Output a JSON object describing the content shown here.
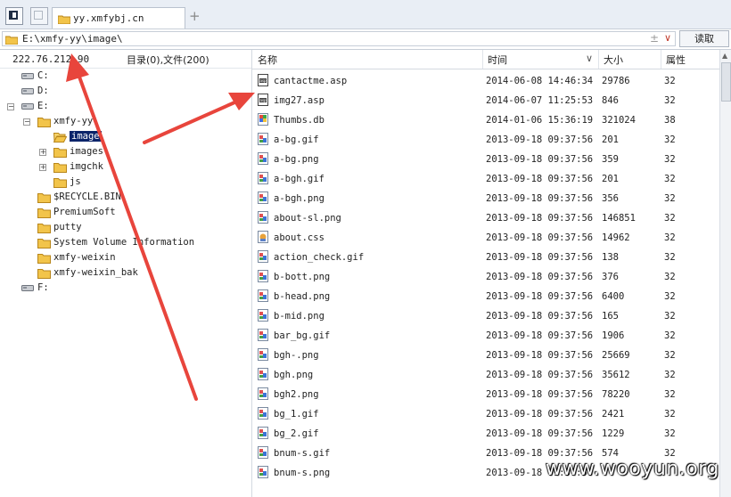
{
  "tabs": {
    "active_label": "yy.xmfybj.cn",
    "add_symbol": "+"
  },
  "address": {
    "path": "E:\\xmfy-yy\\image\\",
    "plus_symbol": "±",
    "dropdown_symbol": "∨",
    "read_button": "读取"
  },
  "left_header": {
    "ip": "222.76.212.90",
    "summary": "目录(0),文件(200)"
  },
  "tree": [
    {
      "label": "C:",
      "type": "drive",
      "depth": 0,
      "expander": ""
    },
    {
      "label": "D:",
      "type": "drive",
      "depth": 0,
      "expander": ""
    },
    {
      "label": "E:",
      "type": "drive",
      "depth": 0,
      "expander": "−"
    },
    {
      "label": "xmfy-yy",
      "type": "folder",
      "depth": 1,
      "expander": "−"
    },
    {
      "label": "image",
      "type": "folder-open",
      "depth": 2,
      "expander": "",
      "selected": true
    },
    {
      "label": "images",
      "type": "folder",
      "depth": 2,
      "expander": "+"
    },
    {
      "label": "imgchk",
      "type": "folder",
      "depth": 2,
      "expander": "+"
    },
    {
      "label": "js",
      "type": "folder",
      "depth": 2,
      "expander": ""
    },
    {
      "label": "$RECYCLE.BIN",
      "type": "folder",
      "depth": 1,
      "expander": ""
    },
    {
      "label": "PremiumSoft",
      "type": "folder",
      "depth": 1,
      "expander": ""
    },
    {
      "label": "putty",
      "type": "folder",
      "depth": 1,
      "expander": ""
    },
    {
      "label": "System Volume Information",
      "type": "folder",
      "depth": 1,
      "expander": ""
    },
    {
      "label": "xmfy-weixin",
      "type": "folder",
      "depth": 1,
      "expander": ""
    },
    {
      "label": "xmfy-weixin_bak",
      "type": "folder",
      "depth": 1,
      "expander": ""
    },
    {
      "label": "F:",
      "type": "drive",
      "depth": 0,
      "expander": ""
    }
  ],
  "columns": {
    "name": "名称",
    "time": "时间",
    "size": "大小",
    "attr": "属性",
    "sort_icon": "∨"
  },
  "files": [
    {
      "name": "cantactme.asp",
      "time": "2014-06-08 14:46:34",
      "size": "29786",
      "attr": "32",
      "icon": "asp"
    },
    {
      "name": "img27.asp",
      "time": "2014-06-07 11:25:53",
      "size": "846",
      "attr": "32",
      "icon": "asp"
    },
    {
      "name": "Thumbs.db",
      "time": "2014-01-06 15:36:19",
      "size": "321024",
      "attr": "38",
      "icon": "db"
    },
    {
      "name": "a-bg.gif",
      "time": "2013-09-18 09:37:56",
      "size": "201",
      "attr": "32",
      "icon": "img"
    },
    {
      "name": "a-bg.png",
      "time": "2013-09-18 09:37:56",
      "size": "359",
      "attr": "32",
      "icon": "img"
    },
    {
      "name": "a-bgh.gif",
      "time": "2013-09-18 09:37:56",
      "size": "201",
      "attr": "32",
      "icon": "img"
    },
    {
      "name": "a-bgh.png",
      "time": "2013-09-18 09:37:56",
      "size": "356",
      "attr": "32",
      "icon": "img"
    },
    {
      "name": "about-sl.png",
      "time": "2013-09-18 09:37:56",
      "size": "146851",
      "attr": "32",
      "icon": "img"
    },
    {
      "name": "about.css",
      "time": "2013-09-18 09:37:56",
      "size": "14962",
      "attr": "32",
      "icon": "css"
    },
    {
      "name": "action_check.gif",
      "time": "2013-09-18 09:37:56",
      "size": "138",
      "attr": "32",
      "icon": "img"
    },
    {
      "name": "b-bott.png",
      "time": "2013-09-18 09:37:56",
      "size": "376",
      "attr": "32",
      "icon": "img"
    },
    {
      "name": "b-head.png",
      "time": "2013-09-18 09:37:56",
      "size": "6400",
      "attr": "32",
      "icon": "img"
    },
    {
      "name": "b-mid.png",
      "time": "2013-09-18 09:37:56",
      "size": "165",
      "attr": "32",
      "icon": "img"
    },
    {
      "name": "bar_bg.gif",
      "time": "2013-09-18 09:37:56",
      "size": "1906",
      "attr": "32",
      "icon": "img"
    },
    {
      "name": "bgh-.png",
      "time": "2013-09-18 09:37:56",
      "size": "25669",
      "attr": "32",
      "icon": "img"
    },
    {
      "name": "bgh.png",
      "time": "2013-09-18 09:37:56",
      "size": "35612",
      "attr": "32",
      "icon": "img"
    },
    {
      "name": "bgh2.png",
      "time": "2013-09-18 09:37:56",
      "size": "78220",
      "attr": "32",
      "icon": "img"
    },
    {
      "name": "bg_1.gif",
      "time": "2013-09-18 09:37:56",
      "size": "2421",
      "attr": "32",
      "icon": "img"
    },
    {
      "name": "bg_2.gif",
      "time": "2013-09-18 09:37:56",
      "size": "1229",
      "attr": "32",
      "icon": "img"
    },
    {
      "name": "bnum-s.gif",
      "time": "2013-09-18 09:37:56",
      "size": "574",
      "attr": "32",
      "icon": "img"
    },
    {
      "name": "bnum-s.png",
      "time": "2013-09-18 09:37:56",
      "size": "",
      "attr": "",
      "icon": "img"
    }
  ],
  "watermark": "www.wooyun.org",
  "colors": {
    "arrow": "#e8453c",
    "selection": "#0a246a",
    "folder": "#f2c44a"
  }
}
